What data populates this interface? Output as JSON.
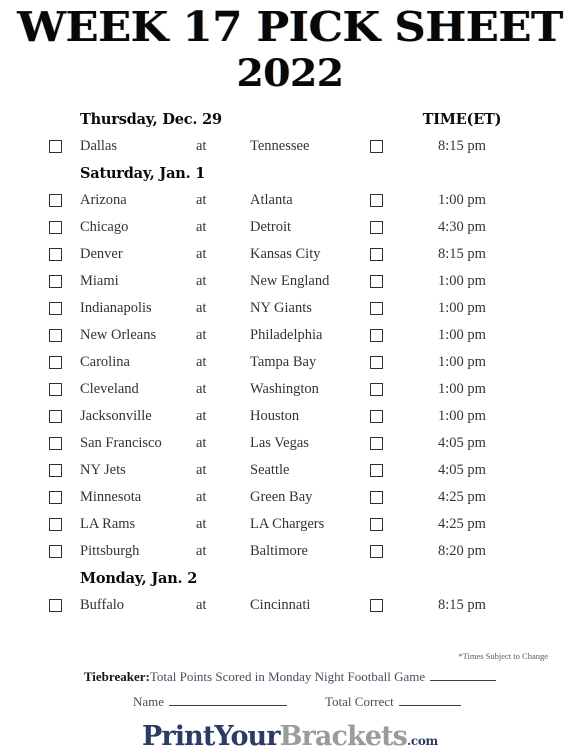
{
  "title": {
    "line1": "WEEK 17 PICK SHEET",
    "line2": "2022"
  },
  "time_column_header": "TIME(ET)",
  "at_word": "at",
  "sections": [
    {
      "day": "Thursday, Dec. 29",
      "games": [
        {
          "away": "Dallas",
          "home": "Tennessee",
          "time": "8:15 pm"
        }
      ]
    },
    {
      "day": "Saturday, Jan. 1",
      "games": [
        {
          "away": "Arizona",
          "home": "Atlanta",
          "time": "1:00 pm"
        },
        {
          "away": "Chicago",
          "home": "Detroit",
          "time": "4:30 pm"
        },
        {
          "away": "Denver",
          "home": "Kansas City",
          "time": "8:15 pm"
        },
        {
          "away": "Miami",
          "home": "New England",
          "time": "1:00 pm"
        },
        {
          "away": "Indianapolis",
          "home": "NY Giants",
          "time": "1:00 pm"
        },
        {
          "away": "New Orleans",
          "home": "Philadelphia",
          "time": "1:00 pm"
        },
        {
          "away": "Carolina",
          "home": "Tampa Bay",
          "time": "1:00 pm"
        },
        {
          "away": "Cleveland",
          "home": "Washington",
          "time": "1:00 pm"
        },
        {
          "away": "Jacksonville",
          "home": "Houston",
          "time": "1:00 pm"
        },
        {
          "away": "San Francisco",
          "home": "Las Vegas",
          "time": "4:05 pm"
        },
        {
          "away": "NY Jets",
          "home": "Seattle",
          "time": "4:05 pm"
        },
        {
          "away": "Minnesota",
          "home": "Green Bay",
          "time": "4:25 pm"
        },
        {
          "away": "LA Rams",
          "home": "LA Chargers",
          "time": "4:25 pm"
        },
        {
          "away": "Pittsburgh",
          "home": "Baltimore",
          "time": "8:20 pm"
        }
      ]
    },
    {
      "day": "Monday, Jan. 2",
      "games": [
        {
          "away": "Buffalo",
          "home": "Cincinnati",
          "time": "8:15 pm"
        }
      ]
    }
  ],
  "footer": {
    "times_note": "*Times Subject to Change",
    "tiebreaker_label": "Tiebreaker:",
    "tiebreaker_text": "Total Points Scored in Monday Night Football Game",
    "name_label": "Name",
    "total_correct_label": "Total Correct",
    "logo_part1": "PrintYour",
    "logo_part2": "Brackets",
    "logo_part3": ".com"
  }
}
